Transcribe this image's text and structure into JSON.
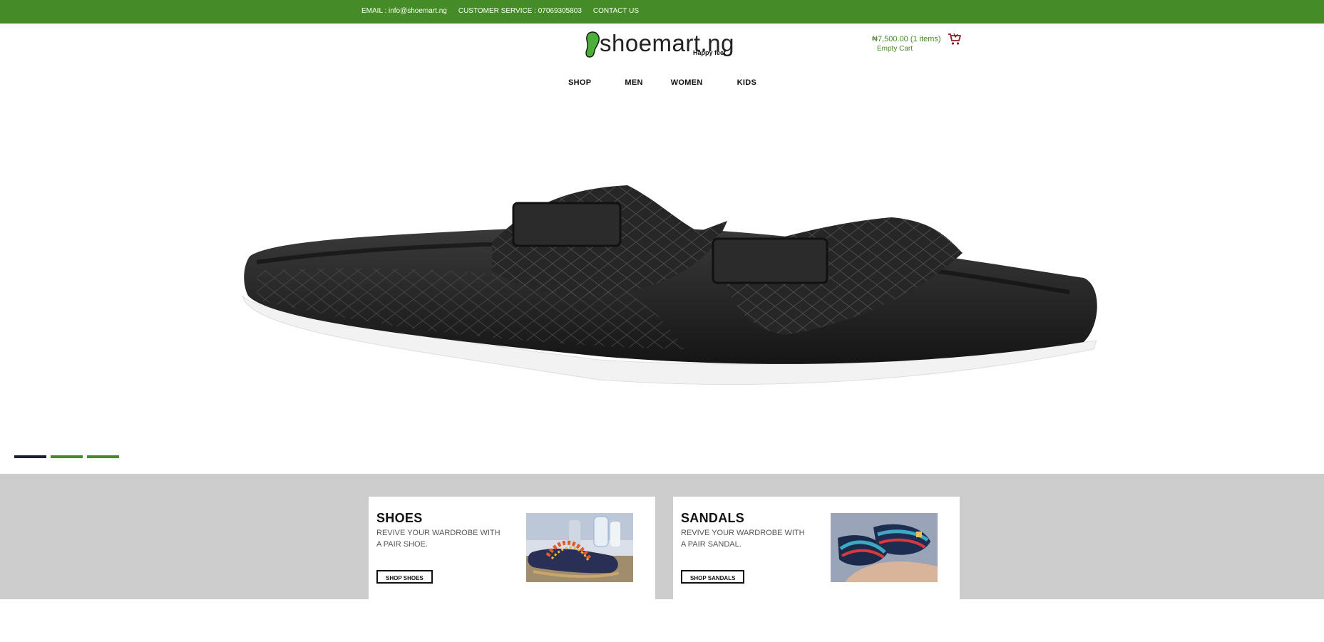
{
  "topbar": {
    "email": "EMAIL : info@shoemart.ng",
    "customer_service": "CUSTOMER SERVICE : 07069305803",
    "contact": "CONTACT US"
  },
  "logo": {
    "brand": "shoemart.ng",
    "tagline": "Happy feet"
  },
  "cart": {
    "total": "₦7,500.00 (1 items)",
    "empty_label": "Empty Cart",
    "icon": "shopping-cart-icon"
  },
  "nav": {
    "items": [
      "SHOP",
      "MEN",
      "WOMEN",
      "KIDS"
    ]
  },
  "slider": {
    "slide_count": 3,
    "active_index": 0
  },
  "promos": [
    {
      "title": "SHOES",
      "description": "REVIVE YOUR WARDROBE WITH A PAIR SHOE.",
      "button": "SHOP SHOES"
    },
    {
      "title": "SANDALS",
      "description": "REVIVE YOUR WARDROBE WITH A PAIR SANDAL.",
      "button": "SHOP SANDALS"
    }
  ],
  "colors": {
    "brand_green": "#458b27",
    "promo_band": "#cccccc",
    "active_dot": "#1b1f2e"
  }
}
